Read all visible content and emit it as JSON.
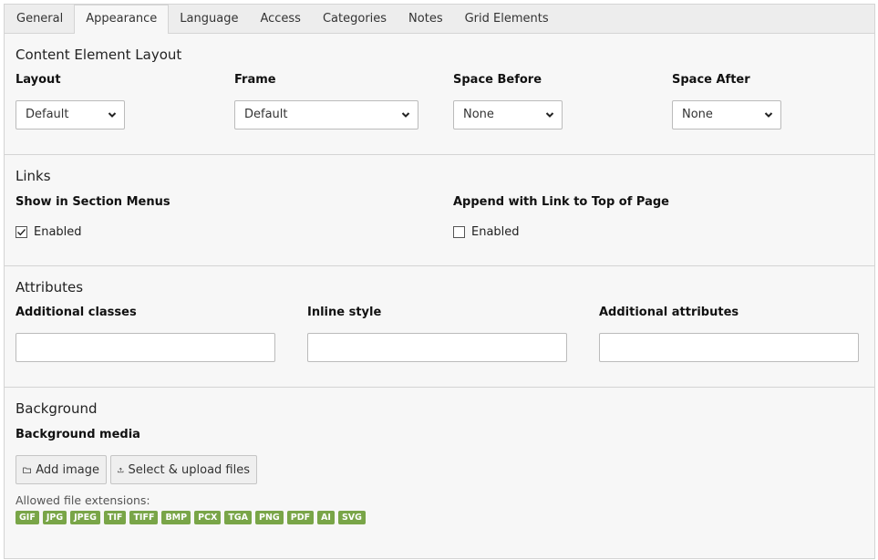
{
  "tabs": [
    {
      "label": "General"
    },
    {
      "label": "Appearance"
    },
    {
      "label": "Language"
    },
    {
      "label": "Access"
    },
    {
      "label": "Categories"
    },
    {
      "label": "Notes"
    },
    {
      "label": "Grid Elements"
    }
  ],
  "active_tab": "Appearance",
  "layout_section": {
    "title": "Content Element Layout",
    "layout": {
      "label": "Layout",
      "value": "Default"
    },
    "frame": {
      "label": "Frame",
      "value": "Default"
    },
    "space_before": {
      "label": "Space Before",
      "value": "None"
    },
    "space_after": {
      "label": "Space After",
      "value": "None"
    }
  },
  "links_section": {
    "title": "Links",
    "section_menus": {
      "label": "Show in Section Menus",
      "option": "Enabled",
      "checked": true
    },
    "link_to_top": {
      "label": "Append with Link to Top of Page",
      "option": "Enabled",
      "checked": false
    }
  },
  "attributes_section": {
    "title": "Attributes",
    "additional_classes": {
      "label": "Additional classes",
      "value": ""
    },
    "inline_style": {
      "label": "Inline style",
      "value": ""
    },
    "additional_attributes": {
      "label": "Additional attributes",
      "value": ""
    }
  },
  "background_section": {
    "title": "Background",
    "media_label": "Background media",
    "add_image_label": "Add image",
    "upload_label": "Select & upload files",
    "allowed_label": "Allowed file extensions:",
    "extensions": [
      "GIF",
      "JPG",
      "JPEG",
      "TIF",
      "TIFF",
      "BMP",
      "PCX",
      "TGA",
      "PNG",
      "PDF",
      "AI",
      "SVG"
    ]
  },
  "colors": {
    "badge": "#79a548",
    "panel": "#f7f7f7",
    "tabbar": "#ededed"
  },
  "icons": {
    "select_arrow": "chevron-down-icon",
    "checkbox_check": "check-icon",
    "add_image": "folder-icon",
    "upload": "upload-icon"
  }
}
